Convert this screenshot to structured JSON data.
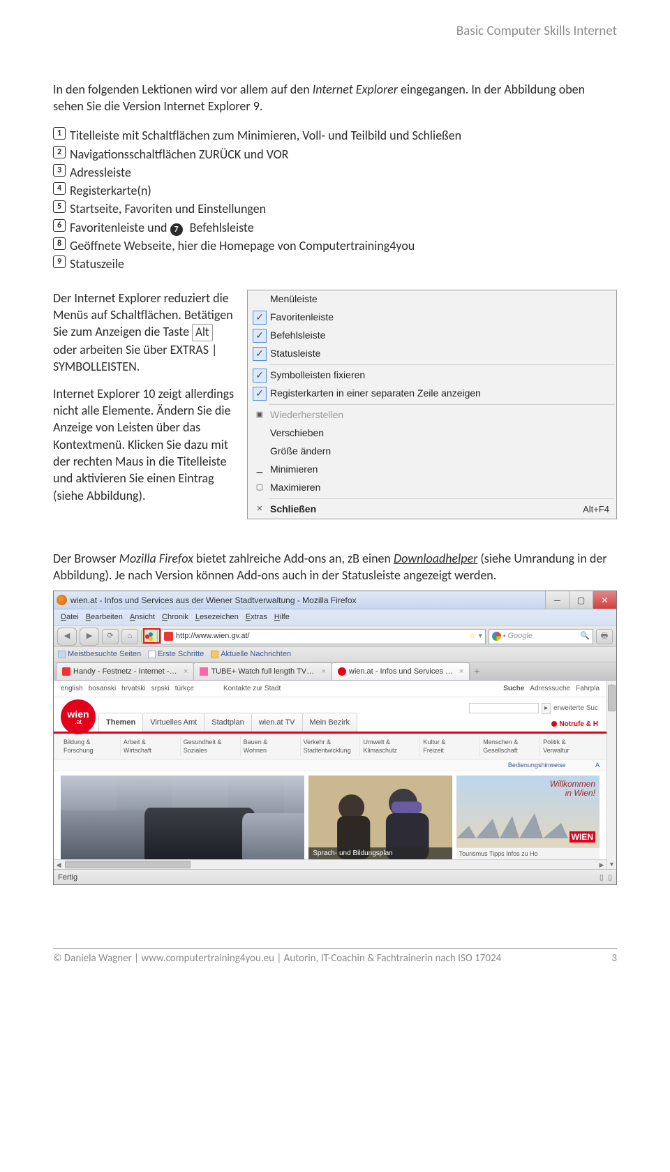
{
  "header": "Basic Computer Skills Internet",
  "intro_1a": "In den folgenden Lektionen wird vor allem auf den ",
  "intro_1b": "Internet Explorer",
  "intro_1c": " eingegangen. In der Abbildung oben sehen Sie die Version Internet Explorer 9.",
  "list": {
    "i1": "Titelleiste mit Schaltflächen zum Minimieren, Voll- und Teilbild und Schließen",
    "i2": "Navigationsschaltflächen ZURÜCK und VOR",
    "i3": "Adressleiste",
    "i4": "Registerkarte(n)",
    "i5": "Startseite, Favoriten und Einstellungen",
    "i6a": "Favoritenleiste und ",
    "i6b": "Befehlsleiste",
    "i8": "Geöffnete Webseite, hier die Homepage von Computertraining4you",
    "i9": "Statuszeile"
  },
  "left": {
    "p1a": "Der Internet Explorer reduziert die Menüs auf Schaltflächen. Betätigen Sie zum Anzeigen die Taste ",
    "key": "Alt",
    "p1b": " oder arbeiten Sie über EXTRAS | SYMBOLLEISTEN.",
    "p2": "Internet Explorer 10 zeigt allerdings nicht alle Elemente. Ändern Sie die Anzeige von Leisten über das Kontextmenü. Klicken Sie dazu mit der rechten Maus in die Titelleiste und aktivieren Sie einen Eintrag (siehe Abbildung)."
  },
  "ctx": {
    "menueleiste": "Menüleiste",
    "favoritenleiste": "Favoritenleiste",
    "befehlsleiste": "Befehlsleiste",
    "statusleiste": "Statusleiste",
    "fixieren": "Symbolleisten fixieren",
    "separateZeile": "Registerkarten in einer separaten Zeile anzeigen",
    "wiederherstellen": "Wiederherstellen",
    "verschieben": "Verschieben",
    "groesse": "Größe ändern",
    "minimieren": "Minimieren",
    "maximieren": "Maximieren",
    "schliessen": "Schließen",
    "altf4": "Alt+F4"
  },
  "ff_para_a": "Der Browser ",
  "ff_para_b": "Mozilla Firefox",
  "ff_para_c": " bietet zahlreiche Add-ons an, zB einen ",
  "ff_para_d": "Downloadhelper",
  "ff_para_e": " (siehe Umrandung in der Abbildung). Je nach Version können Add-ons auch in der Statusleiste angezeigt werden.",
  "ff": {
    "title": "wien.at - Infos und Services aus der Wiener Stadtverwaltung - Mozilla Firefox",
    "menu": {
      "datei": "Datei",
      "bearbeiten": "Bearbeiten",
      "ansicht": "Ansicht",
      "chronik": "Chronik",
      "lesezeichen": "Lesezeichen",
      "extras": "Extras",
      "hilfe": "Hilfe"
    },
    "url": "http://www.wien.gv.at/",
    "search_ph": "Google",
    "bm": {
      "meist": "Meistbesuchte Seiten",
      "erste": "Erste Schritte",
      "news": "Aktuelle Nachrichten"
    },
    "tabs": {
      "t1": "Handy - Festnetz - Internet - Mobile...",
      "t2": "TUBE+ Watch full length TV Shows ...",
      "t3": "wien.at - Infos und Services aus d..."
    },
    "status": "Fertig"
  },
  "site": {
    "langs": [
      "english",
      "bosanski",
      "hrvatski",
      "srpski",
      "türkçe"
    ],
    "kontakte": "Kontakte zur Stadt",
    "suche": "Suche",
    "adrsuche": "Adresssuche",
    "fahrpla": "Fahrpla",
    "erweitert": "erweiterte Suc",
    "logo_top": "wien",
    "logo_bot": ".at",
    "nav": [
      "Themen",
      "Virtuelles Amt",
      "Stadtplan",
      "wien.at TV",
      "Mein Bezirk"
    ],
    "notruf": "Notrufe & H",
    "cats": [
      {
        "a": "Bildung &",
        "b": "Forschung"
      },
      {
        "a": "Arbeit &",
        "b": "Wirtschaft"
      },
      {
        "a": "Gesundheit &",
        "b": "Soziales"
      },
      {
        "a": "Bauen &",
        "b": "Wohnen"
      },
      {
        "a": "Verkehr &",
        "b": "Stadtentwicklung"
      },
      {
        "a": "Umwelt &",
        "b": "Klimaschutz"
      },
      {
        "a": "Kultur &",
        "b": "Freizeit"
      },
      {
        "a": "Menschen &",
        "b": "Gesellschaft"
      },
      {
        "a": "Politik &",
        "b": "Verwaltur"
      }
    ],
    "hints": "Bedienungshinweise",
    "a_right": "A",
    "hero_mid": "Sprach- und Bildungsplan",
    "hero_r_top": "Willkommen\nin Wien!",
    "hero_r_mark": "WIEN",
    "hero_r_foot": "Tourismus Tipps Infos zu Ho"
  },
  "footer_left": "© Daniela Wagner | www.computertraining4you.eu | Autorin, IT-Coachin & Fachtrainerin nach ISO 17024",
  "footer_right": "3"
}
